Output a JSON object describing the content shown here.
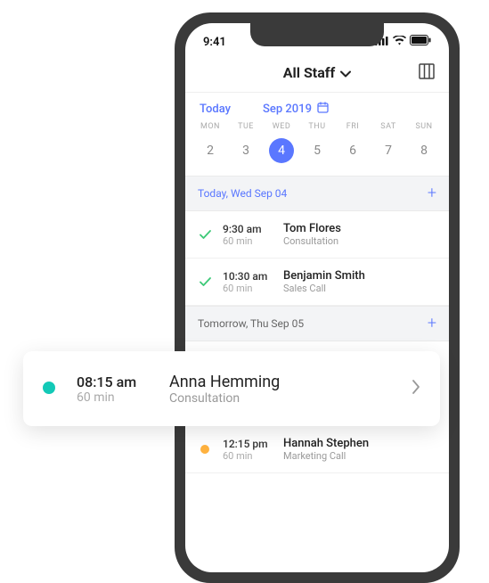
{
  "status": {
    "time": "9:41"
  },
  "header": {
    "title": "All Staff"
  },
  "selector": {
    "today": "Today",
    "month": "Sep 2019"
  },
  "week": [
    {
      "abbr": "MON",
      "num": "2"
    },
    {
      "abbr": "TUE",
      "num": "3"
    },
    {
      "abbr": "WED",
      "num": "4",
      "selected": true
    },
    {
      "abbr": "THU",
      "num": "5"
    },
    {
      "abbr": "FRI",
      "num": "6"
    },
    {
      "abbr": "SAT",
      "num": "7"
    },
    {
      "abbr": "SUN",
      "num": "8"
    }
  ],
  "sections": {
    "today": {
      "label": "Today, Wed Sep 04",
      "items": [
        {
          "time": "9:30 am",
          "duration": "60 min",
          "name": "Tom Flores",
          "type": "Consultation",
          "status": "done"
        },
        {
          "time": "10:30 am",
          "duration": "60 min",
          "name": "Benjamin Smith",
          "type": "Sales Call",
          "status": "done"
        }
      ]
    },
    "tomorrow": {
      "label": "Tomorrow, Thu Sep 05",
      "items": [
        {
          "time": "12:15 pm",
          "duration": "60 min",
          "name": "Hannah Stephen",
          "type": "Marketing Call",
          "status": "pending"
        }
      ]
    }
  },
  "highlight": {
    "time": "08:15 am",
    "duration": "60 min",
    "name": "Anna Hemming",
    "type": "Consultation"
  }
}
